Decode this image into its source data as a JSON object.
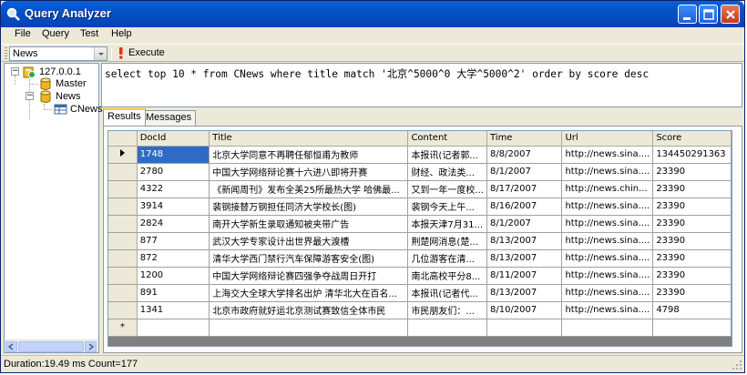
{
  "window": {
    "title": "Query Analyzer"
  },
  "menu": {
    "items": [
      "File",
      "Query",
      "Test",
      "Help"
    ]
  },
  "toolbar": {
    "database": {
      "selected": "News"
    },
    "execute_label": "Execute"
  },
  "tree": {
    "server": "127.0.0.1",
    "databases": [
      {
        "name": "Master"
      },
      {
        "name": "News",
        "tables": [
          "CNews"
        ]
      }
    ]
  },
  "query": {
    "text": "select top 10 * from CNews where title match '北京^5000^0 大学^5000^2' order by score desc"
  },
  "tabs": [
    {
      "label": "Results",
      "active": true
    },
    {
      "label": "Messages",
      "active": false
    }
  ],
  "results": {
    "columns": [
      "DocId",
      "Title",
      "Content",
      "Time",
      "Url",
      "Score"
    ],
    "rows": [
      [
        "1748",
        "北京大学同意不再聘任郁恒甫为教师",
        "本报讯(记者郭...",
        "8/8/2007",
        "http://news.sina....",
        "134450291363"
      ],
      [
        "2780",
        "中国大学网络辩论赛十六进八即将开赛",
        "财经、政法类...",
        "8/1/2007",
        "http://news.sina....",
        "23390"
      ],
      [
        "4322",
        "《新闻周刊》发布全美25所最热大学 哈佛最...",
        "又到一年一度校...",
        "8/17/2007",
        "http://news.chin...",
        "23390"
      ],
      [
        "3914",
        "裴钢接替万钢担任同济大学校长(图)",
        "裴钢今天上午...",
        "8/16/2007",
        "http://news.sina....",
        "23390"
      ],
      [
        "2824",
        "南开大学新生录取通知被夹带广告",
        "本报天津7月31...",
        "8/1/2007",
        "http://news.sina....",
        "23390"
      ],
      [
        "877",
        "武汉大学专家设计出世界最大渡槽",
        "荆楚网消息(楚...",
        "8/13/2007",
        "http://news.sina....",
        "23390"
      ],
      [
        "872",
        "清华大学西门禁行汽车保障游客安全(图)",
        "几位游客在清...",
        "8/13/2007",
        "http://news.sina....",
        "23390"
      ],
      [
        "1200",
        "中国大学网络辩论赛四强争夺战周日开打",
        "南北高校平分8...",
        "8/11/2007",
        "http://news.sina....",
        "23390"
      ],
      [
        "891",
        "上海交大全球大学排名出炉 清华北大在百名...",
        "本报讯(记者代...",
        "8/13/2007",
        "http://news.sina....",
        "23390"
      ],
      [
        "1341",
        "北京市政府就好运北京测试赛致信全体市民",
        "市民朋友们：...",
        "8/10/2007",
        "http://news.sina....",
        "4798"
      ]
    ],
    "new_row_marker": "*"
  },
  "status": {
    "text": "Duration:19.49 ms Count=177"
  },
  "colors": {
    "titlebar": "#0453c5",
    "selection": "#316ac5",
    "window_bg": "#ece9d8",
    "grid_bg": "#808080"
  },
  "icons": {
    "app": "query-analyzer-icon",
    "execute": "exclamation-icon",
    "server": "server-icon",
    "database": "database-icon",
    "table": "table-icon"
  }
}
